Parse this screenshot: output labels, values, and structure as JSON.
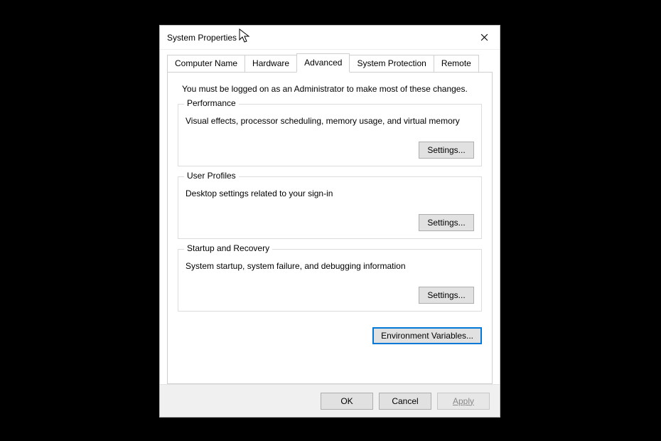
{
  "window": {
    "title": "System Properties"
  },
  "tabs": {
    "computer_name": "Computer Name",
    "hardware": "Hardware",
    "advanced": "Advanced",
    "system_protection": "System Protection",
    "remote": "Remote",
    "active": "advanced"
  },
  "advanced": {
    "notice": "You must be logged on as an Administrator to make most of these changes.",
    "performance": {
      "legend": "Performance",
      "desc": "Visual effects, processor scheduling, memory usage, and virtual memory",
      "button": "Settings..."
    },
    "user_profiles": {
      "legend": "User Profiles",
      "desc": "Desktop settings related to your sign-in",
      "button": "Settings..."
    },
    "startup_recovery": {
      "legend": "Startup and Recovery",
      "desc": "System startup, system failure, and debugging information",
      "button": "Settings..."
    },
    "env_variables": "Environment Variables..."
  },
  "footer": {
    "ok": "OK",
    "cancel": "Cancel",
    "apply": "Apply"
  }
}
